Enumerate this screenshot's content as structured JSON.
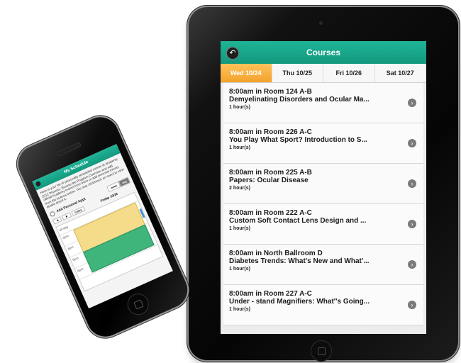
{
  "ipad": {
    "header": {
      "title": "Courses",
      "back_icon": "back-arrow-icon"
    },
    "tabs": [
      {
        "label": "Wed 10/24",
        "active": true
      },
      {
        "label": "Thu 10/25",
        "active": false
      },
      {
        "label": "Fri 10/26",
        "active": false
      },
      {
        "label": "Sat 10/27",
        "active": false
      }
    ],
    "courses": [
      {
        "time_room": "8:00am in Room 124 A-B",
        "title": "Demyelinating Disorders and Ocular Ma...",
        "duration": "1 hour(s)"
      },
      {
        "time_room": "8:00am in Room 226 A-C",
        "title": "You Play What Sport? Introduction to S...",
        "duration": "1 hour(s)"
      },
      {
        "time_room": "8:00am in Room 225 A-B",
        "title": "Papers: Ocular Disease",
        "duration": "2 hour(s)"
      },
      {
        "time_room": "8:00am in Room 222 A-C",
        "title": "Custom Soft Contact Lens Design and ...",
        "duration": "1 hour(s)"
      },
      {
        "time_room": "8:00am in North Ballroom D",
        "title": "Diabetes Trends: What's New and What'...",
        "duration": "1 hour(s)"
      },
      {
        "time_room": "8:00am in Room 227 A-C",
        "title": "Under - stand Magnifiers: What''s Going...",
        "duration": "1 hour(s)"
      }
    ],
    "colors": {
      "header": "#17a58a",
      "active_tab": "#f3a22c"
    }
  },
  "iphone": {
    "header": {
      "title": "My Schedule"
    },
    "intro_text": "Here is your list of personally scheduled events at Academy 2012 Phoenix. Browse the Program Overview and add official Academy events from there or add personal events from the buttons below. You may click/touch an event to view details about it.",
    "add_personal": "Add Personal Appt",
    "view_toggle": {
      "week": "week",
      "day": "day"
    },
    "nav": {
      "prev": "◄",
      "next": "►",
      "today": "today",
      "day_label": "Friday 10/26"
    },
    "calendar": {
      "all_day": "all-day",
      "hours": [
        "3pm",
        "4pm",
        "5pm",
        "6pm"
      ]
    }
  }
}
